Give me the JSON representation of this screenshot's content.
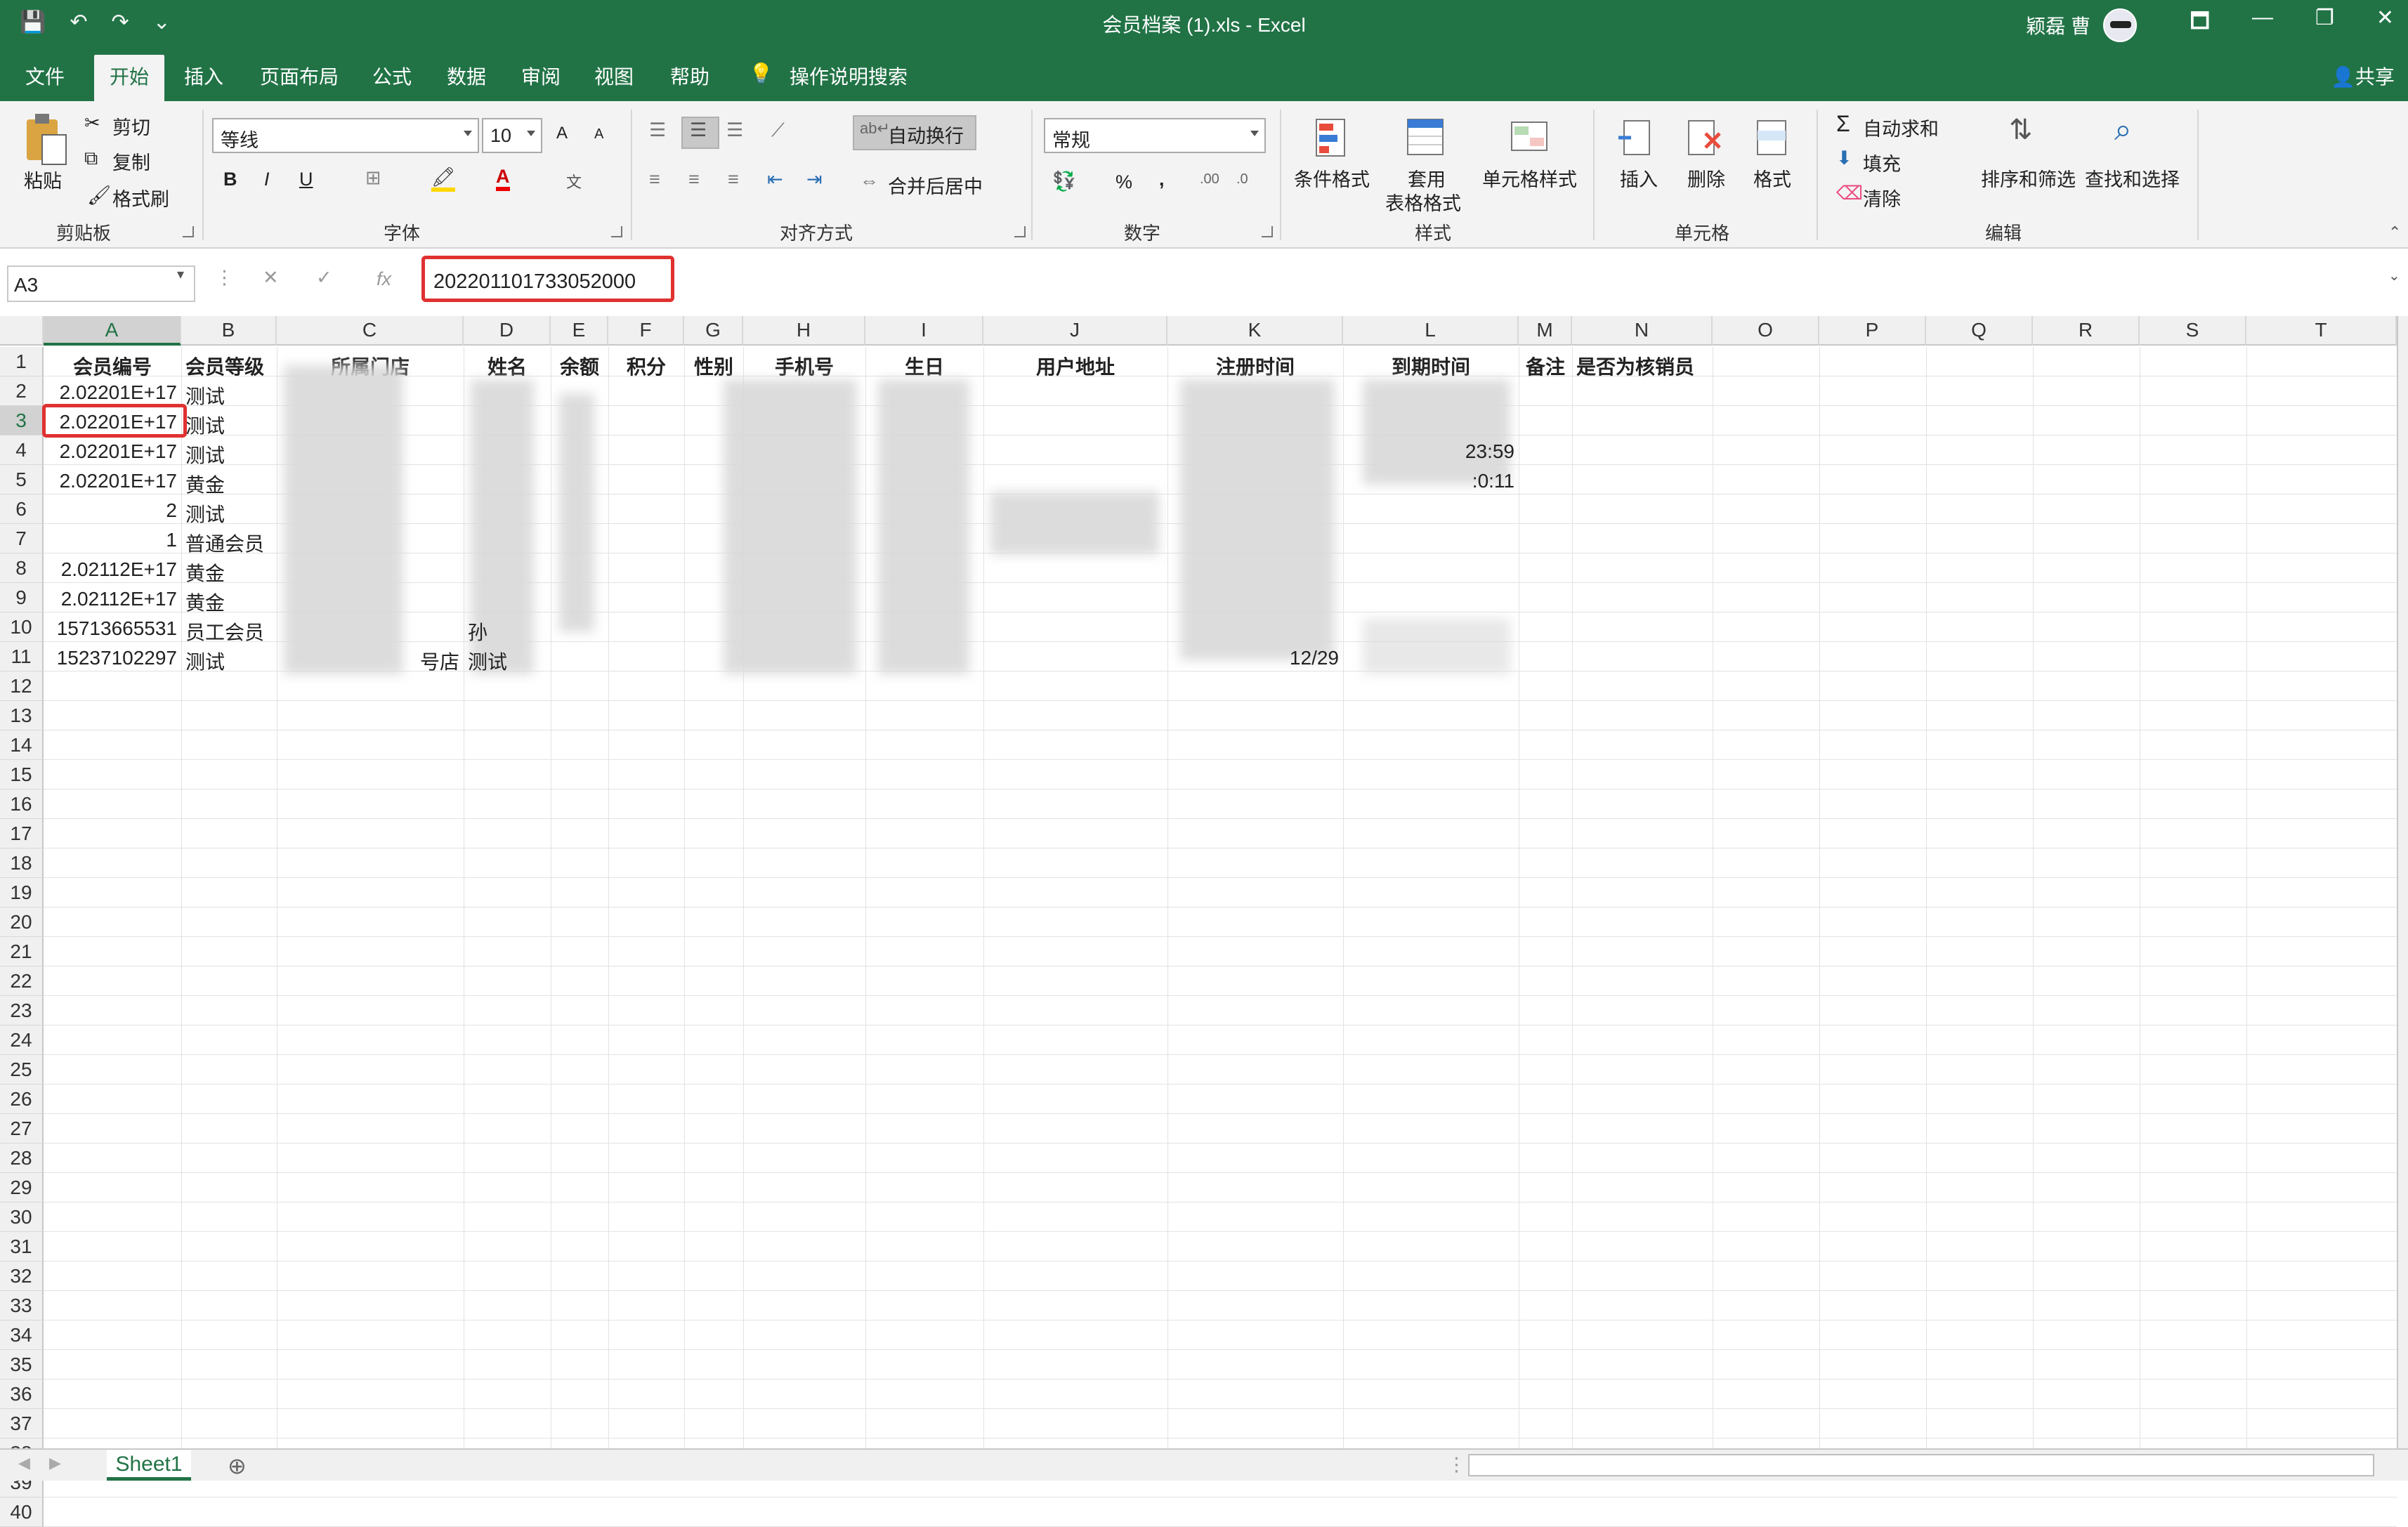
{
  "app": {
    "title": "会员档案 (1).xls  -  Excel",
    "user": "颖磊 曹",
    "share": "共享",
    "quick_access": [
      "💾",
      "↶",
      "↷",
      "⌄"
    ],
    "window_controls": [
      "🗖",
      "—",
      "❐",
      "✕"
    ]
  },
  "tabs": [
    "文件",
    "开始",
    "插入",
    "页面布局",
    "公式",
    "数据",
    "审阅",
    "视图",
    "帮助",
    "操作说明搜索"
  ],
  "ribbon": {
    "clipboard": {
      "paste": "粘贴",
      "cut": "剪切",
      "copy": "复制",
      "format_painter": "格式刷",
      "label": "剪贴板"
    },
    "font": {
      "name": "等线",
      "size": "10",
      "label": "字体",
      "bold": "B",
      "italic": "I",
      "underline": "U",
      "grow": "A",
      "shrink": "A",
      "phonetic": "文"
    },
    "alignment": {
      "wrap": "自动换行",
      "merge": "合并后居中",
      "label": "对齐方式"
    },
    "number": {
      "format": "常规",
      "percent": "%",
      "comma": ",",
      "label": "数字"
    },
    "styles": {
      "conditional": "条件格式",
      "table1": "套用",
      "table2": "表格格式",
      "cell_styles": "单元格样式",
      "label": "样式"
    },
    "cells": {
      "insert": "插入",
      "delete": "删除",
      "format": "格式",
      "label": "单元格"
    },
    "editing": {
      "autosum": "自动求和",
      "fill": "填充",
      "clear": "清除",
      "sort": "排序和筛选",
      "find": "查找和选择",
      "label": "编辑"
    }
  },
  "formula_bar": {
    "name_box": "A3",
    "value": "202201101733052000",
    "fx": "fx",
    "cancel": "✕",
    "enter": "✓"
  },
  "columns": [
    "A",
    "B",
    "C",
    "D",
    "E",
    "F",
    "G",
    "H",
    "I",
    "J",
    "K",
    "L",
    "M",
    "N",
    "O",
    "P",
    "Q",
    "R",
    "S",
    "T"
  ],
  "headers": [
    "会员编号",
    "会员等级",
    "所属门店",
    "姓名",
    "余额",
    "积分",
    "性别",
    "手机号",
    "生日",
    "用户地址",
    "注册时间",
    "到期时间",
    "备注",
    "是否为核销员"
  ],
  "rows": [
    {
      "a": "2.02201E+17",
      "b": "测试"
    },
    {
      "a": "2.02201E+17",
      "b": "测试"
    },
    {
      "a": "2.02201E+17",
      "b": "测试",
      "l": "23:59"
    },
    {
      "a": "2.02201E+17",
      "b": "黄金",
      "l": ":0:11"
    },
    {
      "a": "2",
      "b": "测试"
    },
    {
      "a": "1",
      "b": "普通会员"
    },
    {
      "a": "2.02112E+17",
      "b": "黄金"
    },
    {
      "a": "2.02112E+17",
      "b": "黄金"
    },
    {
      "a": "15713665531",
      "b": "员工会员",
      "d": "孙"
    },
    {
      "a": "15237102297",
      "b": "测试",
      "c": "号店",
      "d": "测试",
      "k": "12/29"
    }
  ],
  "row_numbers": [
    "1",
    "2",
    "3",
    "4",
    "5",
    "6",
    "7",
    "8",
    "9",
    "10",
    "11",
    "12",
    "13",
    "14",
    "15",
    "16",
    "17",
    "18",
    "19",
    "20",
    "21",
    "22",
    "23",
    "24",
    "25",
    "26",
    "27",
    "28",
    "29",
    "30",
    "31",
    "32",
    "33",
    "34",
    "35",
    "36",
    "37",
    "38",
    "39",
    "40"
  ],
  "sheet_tab": "Sheet1",
  "add_sheet": "⊕"
}
